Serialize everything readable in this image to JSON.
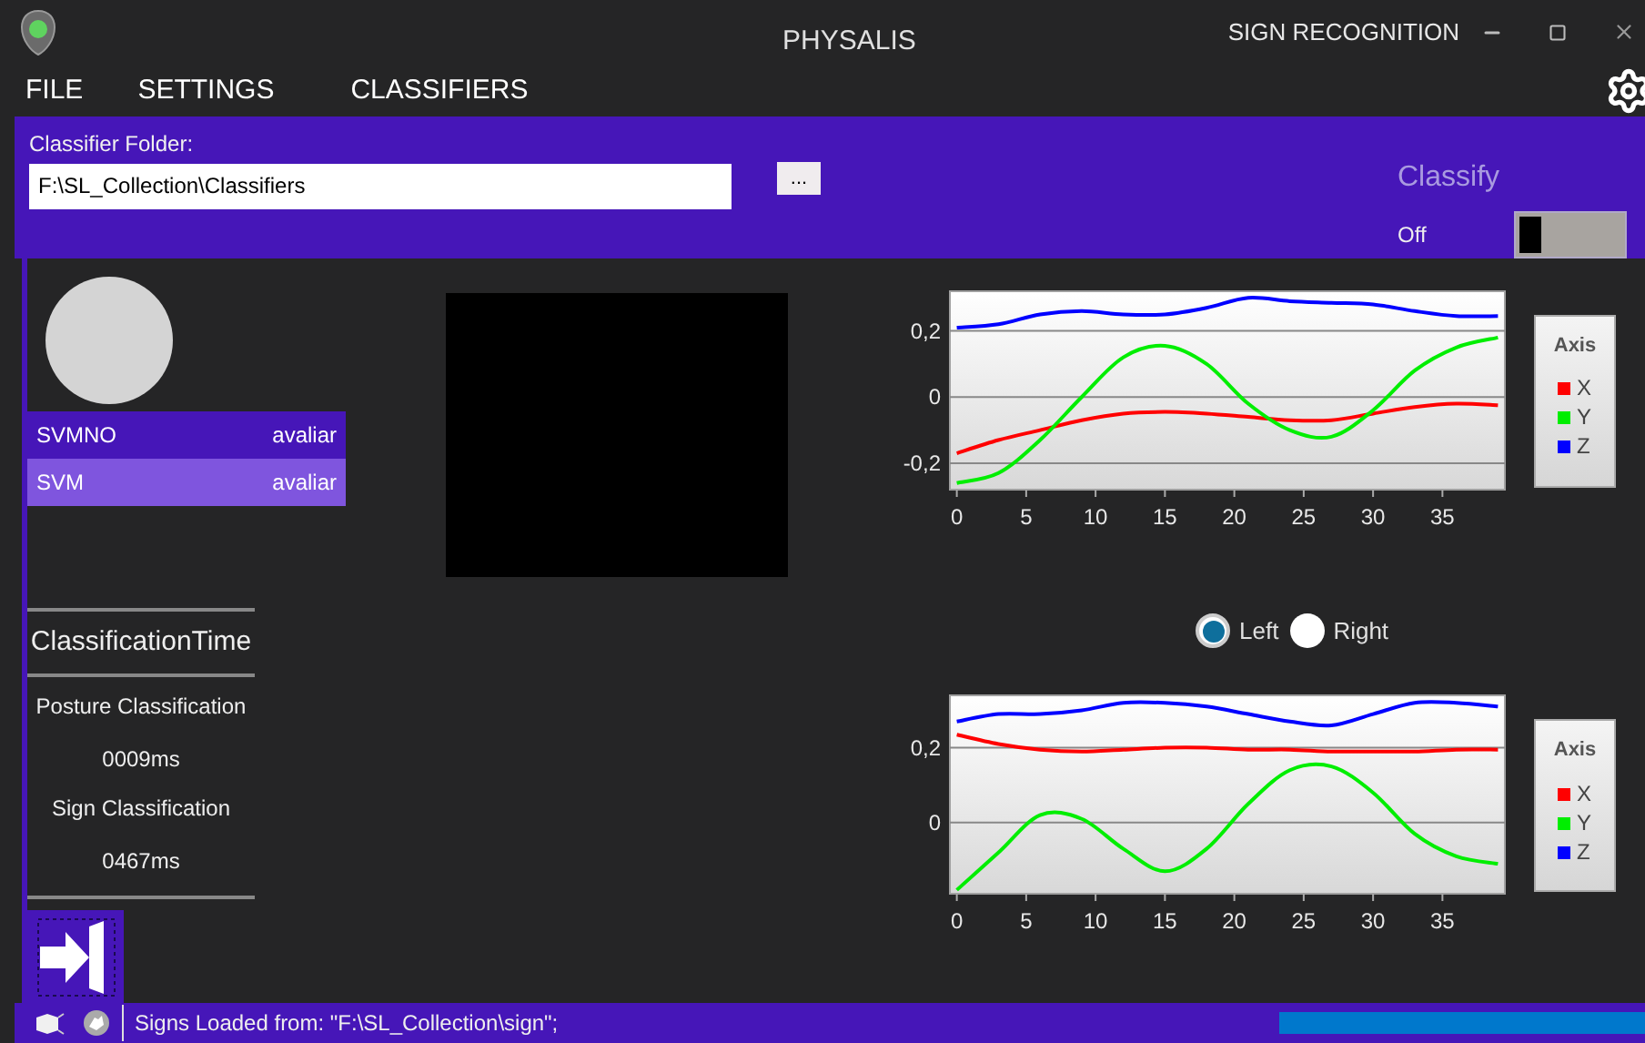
{
  "window": {
    "title": "PHYSALIS",
    "mode": "SIGN RECOGNITION"
  },
  "menu": [
    {
      "label": "FILE"
    },
    {
      "label": "SETTINGS"
    },
    {
      "label": "CLASSIFIERS"
    }
  ],
  "classifier_folder": {
    "label": "Classifier Folder:",
    "value": "F:\\SL_Collection\\Classifiers",
    "browse_button": "..."
  },
  "classify": {
    "label": "Classify",
    "state_label": "Off",
    "on": false
  },
  "classifiers": [
    {
      "name": "SVMNO",
      "action": "avaliar",
      "selected": false
    },
    {
      "name": "SVM",
      "action": "avaliar",
      "selected": true
    }
  ],
  "classification_time": {
    "title": "ClassificationTime",
    "rows": [
      {
        "label": "Posture Classification",
        "value": "0009ms"
      },
      {
        "label": "Sign Classification",
        "value": "0467ms"
      }
    ]
  },
  "hand_selector": [
    {
      "label": "Left",
      "selected": true
    },
    {
      "label": "Right",
      "selected": false
    }
  ],
  "charts": [
    {
      "legend_title": "Axis",
      "chart_data": {
        "type": "line",
        "grid": true,
        "x": [
          0,
          3,
          6,
          9,
          12,
          15,
          18,
          21,
          24,
          27,
          30,
          33,
          36,
          39
        ],
        "xlim": [
          -0.5,
          39.5
        ],
        "ylim": [
          -0.28,
          0.32
        ],
        "xticks": [
          0,
          5,
          10,
          15,
          20,
          25,
          30,
          35
        ],
        "yticks": [
          {
            "value": -0.2,
            "label": "-0,2"
          },
          {
            "value": 0,
            "label": "0"
          },
          {
            "value": 0.2,
            "label": "0,2"
          }
        ],
        "series": [
          {
            "name": "X",
            "color": "#ff0000",
            "values": [
              -0.17,
              -0.13,
              -0.1,
              -0.07,
              -0.05,
              -0.045,
              -0.05,
              -0.06,
              -0.07,
              -0.07,
              -0.05,
              -0.03,
              -0.02,
              -0.025
            ]
          },
          {
            "name": "Y",
            "color": "#00ee00",
            "values": [
              -0.26,
              -0.23,
              -0.13,
              0.0,
              0.12,
              0.155,
              0.1,
              -0.02,
              -0.1,
              -0.12,
              -0.04,
              0.08,
              0.15,
              0.18
            ]
          },
          {
            "name": "Z",
            "color": "#0000ff",
            "values": [
              0.21,
              0.22,
              0.25,
              0.26,
              0.25,
              0.25,
              0.27,
              0.3,
              0.29,
              0.285,
              0.28,
              0.26,
              0.245,
              0.245
            ]
          }
        ]
      }
    },
    {
      "legend_title": "Axis",
      "chart_data": {
        "type": "line",
        "grid": true,
        "x": [
          0,
          3,
          6,
          9,
          12,
          15,
          18,
          21,
          24,
          27,
          30,
          33,
          36,
          39
        ],
        "xlim": [
          -0.5,
          39.5
        ],
        "ylim": [
          -0.19,
          0.34
        ],
        "xticks": [
          0,
          5,
          10,
          15,
          20,
          25,
          30,
          35
        ],
        "yticks": [
          {
            "value": 0,
            "label": "0"
          },
          {
            "value": 0.2,
            "label": "0,2"
          }
        ],
        "series": [
          {
            "name": "X",
            "color": "#ff0000",
            "values": [
              0.235,
              0.21,
              0.195,
              0.19,
              0.195,
              0.2,
              0.2,
              0.195,
              0.195,
              0.19,
              0.19,
              0.19,
              0.195,
              0.195
            ]
          },
          {
            "name": "Y",
            "color": "#00ee00",
            "values": [
              -0.18,
              -0.08,
              0.02,
              0.01,
              -0.07,
              -0.13,
              -0.07,
              0.05,
              0.14,
              0.15,
              0.08,
              -0.03,
              -0.09,
              -0.11
            ]
          },
          {
            "name": "Z",
            "color": "#0000ff",
            "values": [
              0.27,
              0.29,
              0.29,
              0.3,
              0.32,
              0.32,
              0.31,
              0.29,
              0.27,
              0.26,
              0.29,
              0.32,
              0.32,
              0.31
            ]
          }
        ]
      }
    }
  ],
  "status_bar": {
    "text": "Signs Loaded from: \"F:\\SL_Collection\\sign\";",
    "progress": {
      "level": 1
    }
  }
}
